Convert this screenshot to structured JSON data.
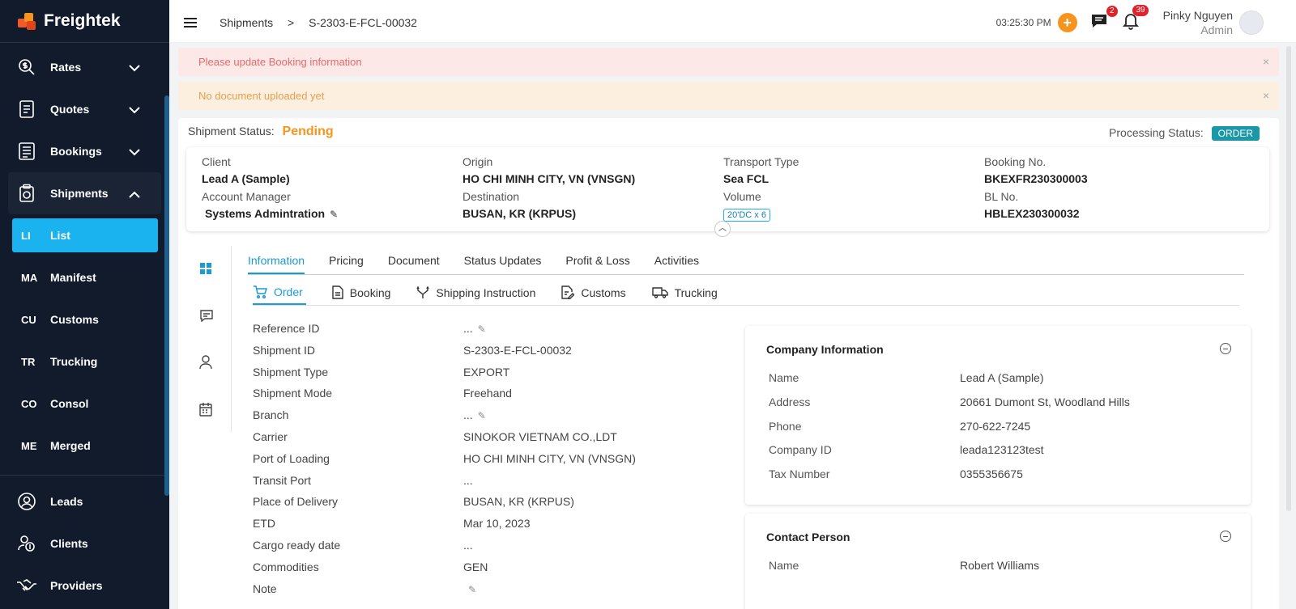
{
  "brand": {
    "name": "Freightek"
  },
  "sidebar": {
    "items": [
      {
        "label": "Rates",
        "icon": "dollar-search-icon"
      },
      {
        "label": "Quotes",
        "icon": "document-icon"
      },
      {
        "label": "Bookings",
        "icon": "list-doc-icon"
      },
      {
        "label": "Shipments",
        "icon": "clipboard-icon"
      },
      {
        "abbr": "LI",
        "label": "List"
      },
      {
        "abbr": "MA",
        "label": "Manifest"
      },
      {
        "abbr": "CU",
        "label": "Customs"
      },
      {
        "abbr": "TR",
        "label": "Trucking"
      },
      {
        "abbr": "CO",
        "label": "Consol"
      },
      {
        "abbr": "ME",
        "label": "Merged"
      },
      {
        "label": "Leads",
        "icon": "user-circle-icon"
      },
      {
        "label": "Clients",
        "icon": "client-dollar-icon"
      },
      {
        "label": "Providers",
        "icon": "handshake-icon"
      }
    ]
  },
  "header": {
    "breadcrumb": {
      "root": "Shipments",
      "sep": ">",
      "current": "S-2303-E-FCL-00032"
    },
    "time": "03:25:30 PM",
    "plus": "+",
    "messages_count": "2",
    "notifications_count": "39",
    "user_name": "Pinky Nguyen",
    "user_role": "Admin"
  },
  "alerts": [
    {
      "text": "Please update Booking information",
      "close": "×"
    },
    {
      "text": "No document uploaded yet",
      "close": "×"
    }
  ],
  "status": {
    "label": "Shipment Status:",
    "value": "Pending",
    "processing_label": "Processing Status:",
    "processing_value": "ORDER"
  },
  "summary": {
    "client_label": "Client",
    "client": "Lead A (Sample)",
    "am_label": "Account Manager",
    "am": "Systems Admintration",
    "origin_label": "Origin",
    "origin": "HO CHI MINH CITY, VN (VNSGN)",
    "dest_label": "Destination",
    "dest": "BUSAN, KR (KRPUS)",
    "transport_label": "Transport Type",
    "transport": "Sea FCL",
    "volume_label": "Volume",
    "volume": "20'DC x 6",
    "booking_label": "Booking No.",
    "booking": "BKEXFR230300003",
    "bl_label": "BL No.",
    "bl": "HBLEX230300032"
  },
  "tabs": [
    "Information",
    "Pricing",
    "Document",
    "Status Updates",
    "Profit & Loss",
    "Activities"
  ],
  "subtabs": [
    "Order",
    "Booking",
    "Shipping Instruction",
    "Customs",
    "Trucking"
  ],
  "fields": [
    {
      "label": "Reference ID",
      "value": "..."
    },
    {
      "label": "Shipment ID",
      "value": "S-2303-E-FCL-00032"
    },
    {
      "label": "Shipment Type",
      "value": "EXPORT"
    },
    {
      "label": "Shipment Mode",
      "value": "Freehand"
    },
    {
      "label": "Branch",
      "value": "..."
    },
    {
      "label": "Carrier",
      "value": "SINOKOR VIETNAM CO.,LDT"
    },
    {
      "label": "Port of Loading",
      "value": "HO CHI MINH CITY, VN (VNSGN)"
    },
    {
      "label": "Transit Port",
      "value": "..."
    },
    {
      "label": "Place of Delivery",
      "value": "BUSAN, KR (KRPUS)"
    },
    {
      "label": "ETD",
      "value": "Mar 10, 2023"
    },
    {
      "label": "Cargo ready date",
      "value": "..."
    },
    {
      "label": "Commodities",
      "value": "GEN"
    },
    {
      "label": "Note",
      "value": ""
    }
  ],
  "company": {
    "title": "Company Information",
    "rows": [
      {
        "label": "Name",
        "value": "Lead A (Sample)"
      },
      {
        "label": "Address",
        "value": "20661 Dumont St, Woodland Hills"
      },
      {
        "label": "Phone",
        "value": "270-622-7245"
      },
      {
        "label": "Company ID",
        "value": "leada123123test"
      },
      {
        "label": "Tax Number",
        "value": "0355356675"
      }
    ]
  },
  "contact": {
    "title": "Contact Person",
    "rows": [
      {
        "label": "Name",
        "value": "Robert Williams"
      }
    ]
  }
}
